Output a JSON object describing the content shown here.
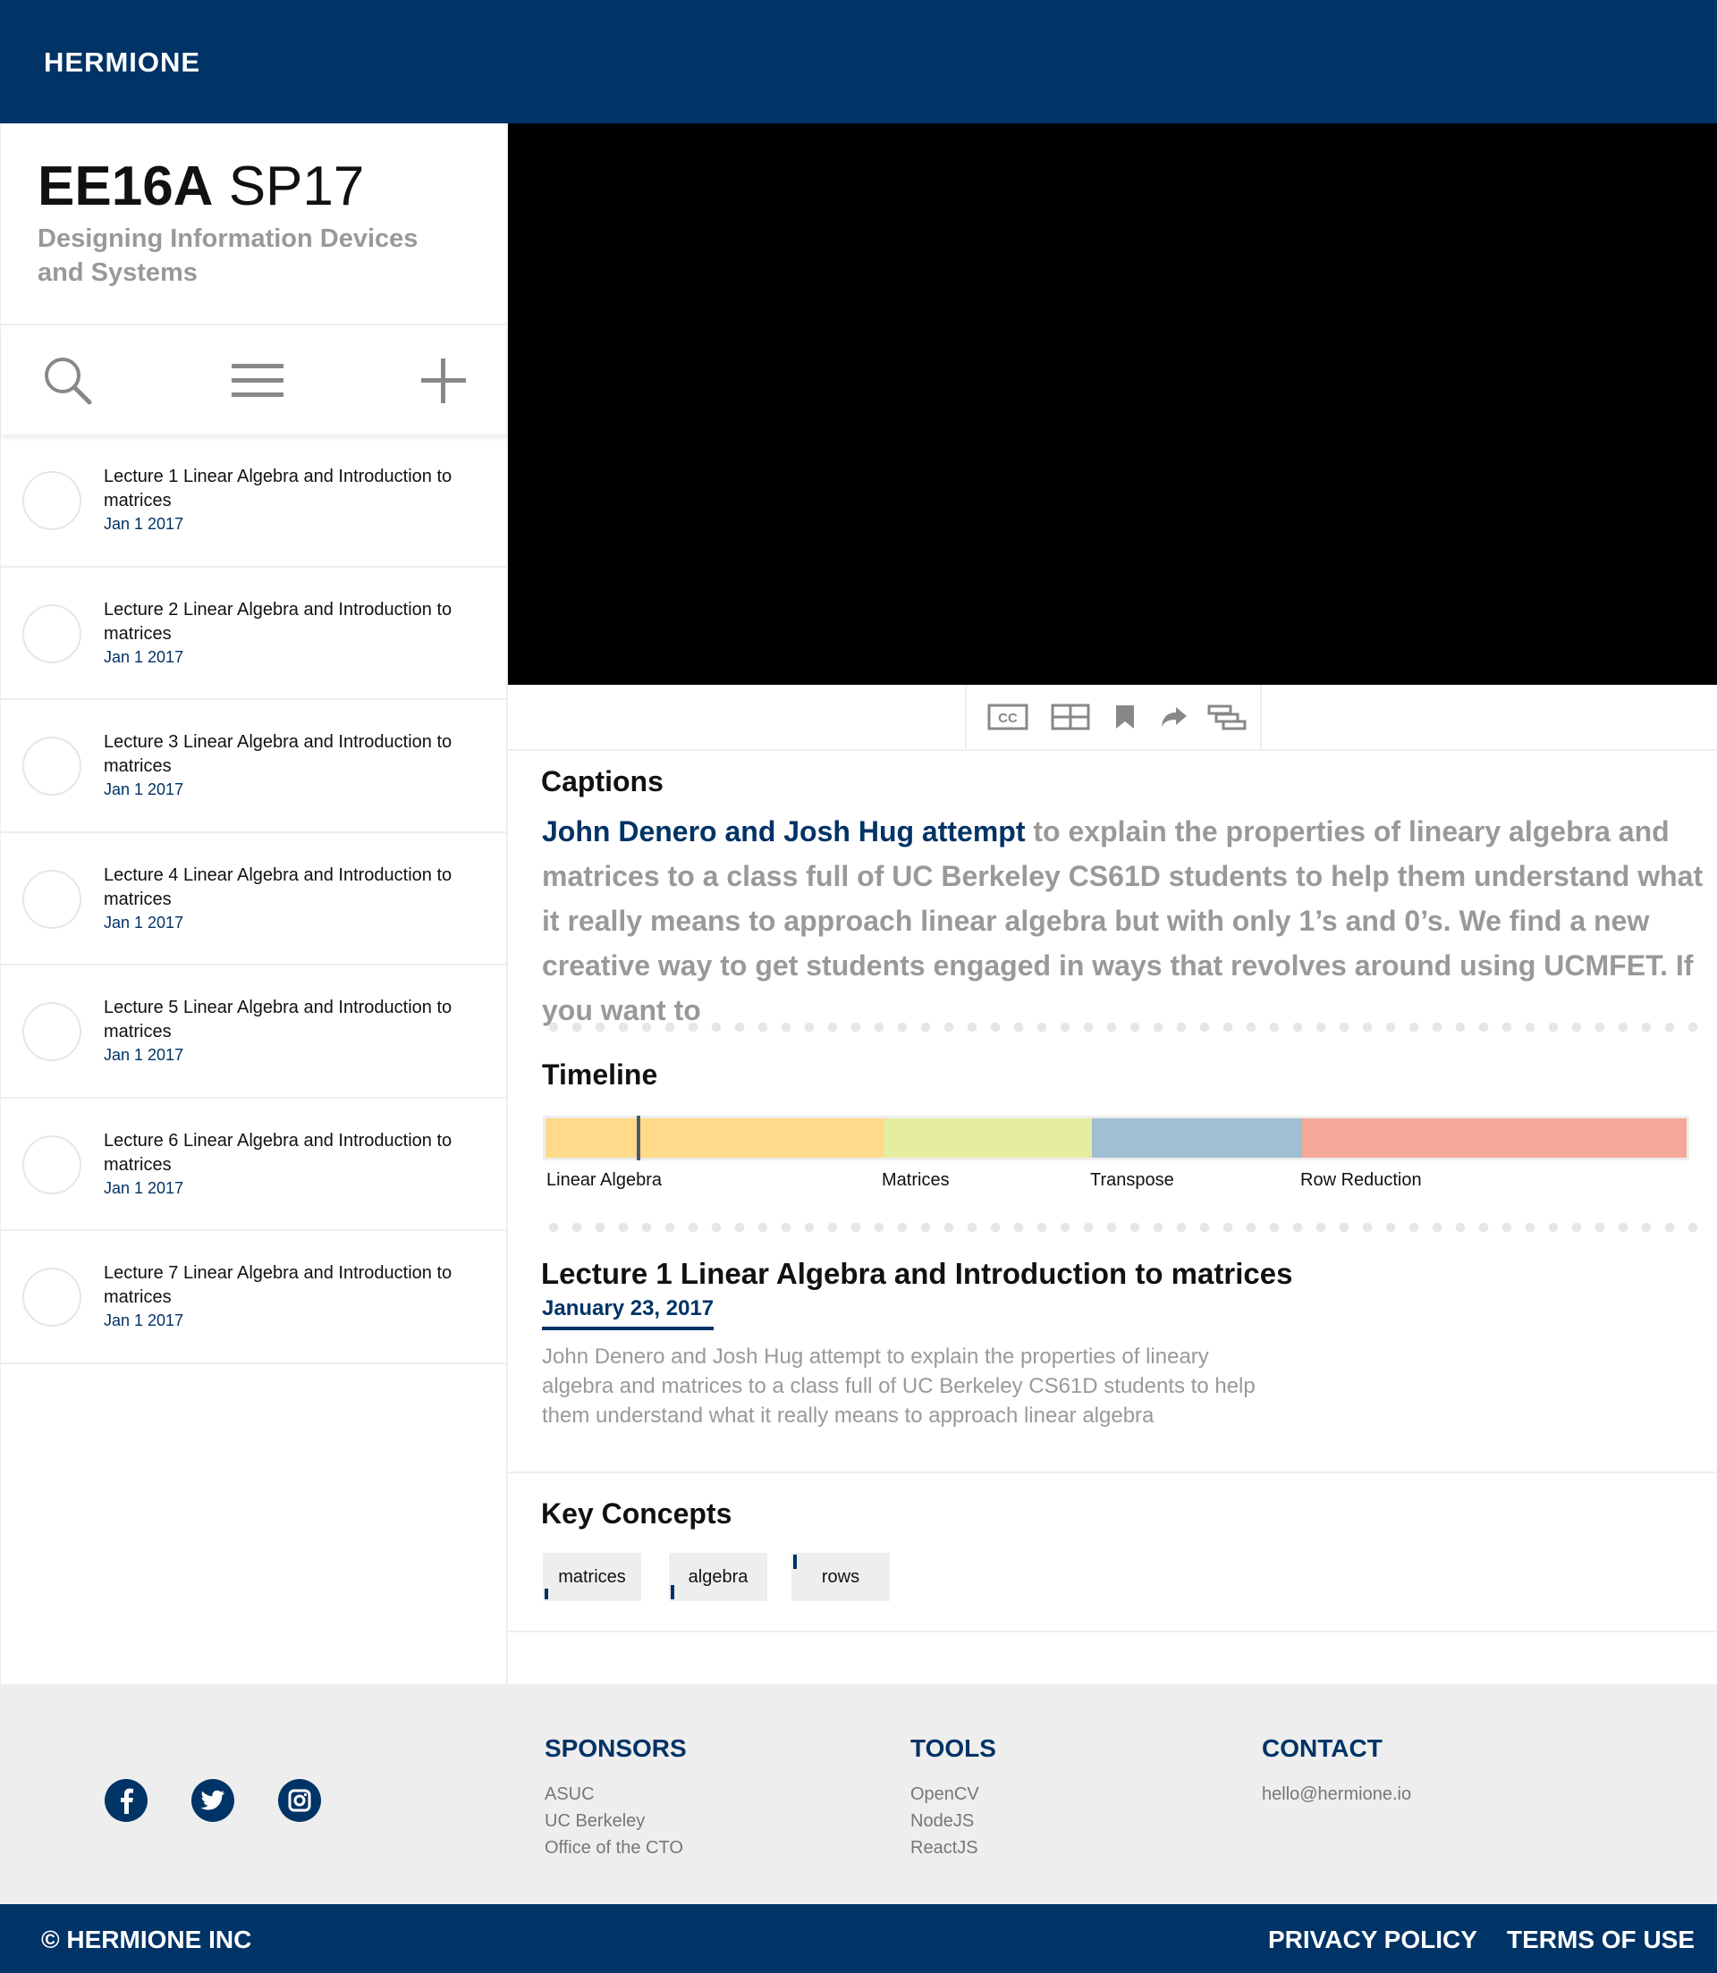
{
  "header": {
    "brand": "HERMIONE"
  },
  "course": {
    "code": "EE16A",
    "term": "SP17",
    "subtitle": "Designing Information Devices and Systems"
  },
  "toolbar": {
    "icons": [
      "search-icon",
      "menu-icon",
      "plus-icon"
    ]
  },
  "lectures": [
    {
      "title": "Lecture 1 Linear Algebra and Introduction to matrices",
      "date": "Jan 1 2017"
    },
    {
      "title": "Lecture 2 Linear Algebra and Introduction to matrices",
      "date": "Jan 1 2017"
    },
    {
      "title": "Lecture 3 Linear Algebra and Introduction to matrices",
      "date": "Jan 1 2017"
    },
    {
      "title": "Lecture 4 Linear Algebra and Introduction to matrices",
      "date": "Jan 1 2017"
    },
    {
      "title": "Lecture 5 Linear Algebra and Introduction to matrices",
      "date": "Jan 1 2017"
    },
    {
      "title": "Lecture 6 Linear Algebra and Introduction to matrices",
      "date": "Jan 1 2017"
    },
    {
      "title": "Lecture 7 Linear Algebra and Introduction to matrices",
      "date": "Jan 1 2017"
    }
  ],
  "video_controls": {
    "cc_label": "CC",
    "icons": [
      "cc-icon",
      "layout-icon",
      "bookmark-icon",
      "share-icon",
      "stack-icon"
    ]
  },
  "captions": {
    "heading": "Captions",
    "highlight": "John Denero and Josh Hug attempt",
    "rest": " to explain the properties of lineary algebra and matrices to a class full of UC Berkeley CS61D students to help them understand what it really means to approach linear algebra but with only 1’s and 0’s. We find a new creative way to get students engaged in ways that revolves around using UCMFET. If you want to"
  },
  "timeline": {
    "heading": "Timeline",
    "segments": [
      {
        "label": "Linear Algebra",
        "color": "#FFDA8A",
        "fraction": 0.296
      },
      {
        "label": "Matrices",
        "color": "#E5EDA0",
        "fraction": 0.183
      },
      {
        "label": "Transpose",
        "color": "#A0BFD3",
        "fraction": 0.184
      },
      {
        "label": "Row Reduction",
        "color": "#F5A89A",
        "fraction": 0.337
      }
    ],
    "playhead_fraction": 0.08
  },
  "lecture_detail": {
    "title": "Lecture 1 Linear Algebra and Introduction to matrices",
    "date": "January 23, 2017",
    "description": "John Denero and Josh Hug attempt to explain the properties of lineary algebra and matrices to a class full of UC Berkeley CS61D students to help them understand what it really means to approach linear algebra"
  },
  "key_concepts": {
    "heading": "Key Concepts",
    "tags": [
      "matrices",
      "algebra",
      "rows"
    ]
  },
  "footer": {
    "social": [
      "facebook-icon",
      "twitter-icon",
      "instagram-icon"
    ],
    "sponsors": {
      "title": "SPONSORS",
      "items": [
        "ASUC",
        "UC Berkeley",
        "Office of the CTO"
      ]
    },
    "tools": {
      "title": "TOOLS",
      "items": [
        "OpenCV",
        "NodeJS",
        "ReactJS"
      ]
    },
    "contact": {
      "title": "CONTACT",
      "email": "hello@hermione.io"
    }
  },
  "bottom": {
    "copyright": "© HERMIONE INC",
    "privacy": "PRIVACY POLICY",
    "terms": "TERMS OF USE"
  },
  "colors": {
    "brand": "#003366",
    "muted": "#999999",
    "panel": "#EEEEEE"
  }
}
